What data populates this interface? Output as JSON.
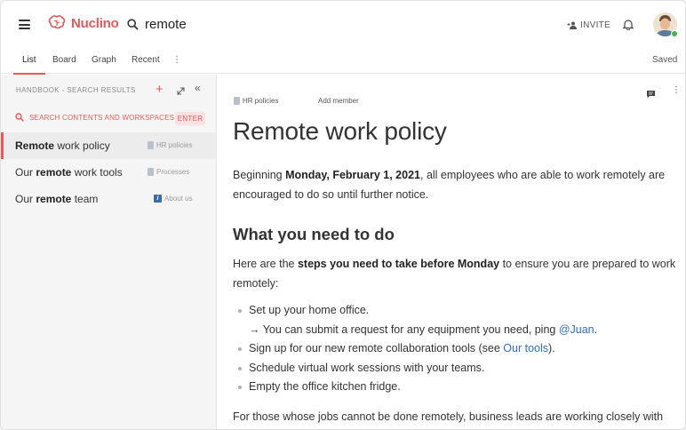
{
  "app": {
    "logo_text": "Nuclino",
    "search_query": "remote",
    "invite_label": "INVITE",
    "brand_color": "#e25a5a"
  },
  "tabs": [
    {
      "label": "List",
      "active": true
    },
    {
      "label": "Board",
      "active": false
    },
    {
      "label": "Graph",
      "active": false
    },
    {
      "label": "Recent",
      "active": false
    }
  ],
  "more_glyph": "⋮",
  "status": "Saved",
  "sidebar": {
    "header": "HANDBOOK - SEARCH RESULTS",
    "search_contents_label": "SEARCH CONTENTS AND WORKSPACES",
    "enter_label": "ENTER",
    "results": [
      {
        "pre": "",
        "bold": "Remote",
        "post": " work policy",
        "workspace": "HR policies",
        "icon": "doc-icon",
        "active": true
      },
      {
        "pre": "Our ",
        "bold": "remote",
        "post": " work tools",
        "workspace": "Processes",
        "icon": "doc-icon",
        "active": false
      },
      {
        "pre": "Our ",
        "bold": "remote",
        "post": " team",
        "workspace": "About us",
        "icon": "info-icon",
        "active": false
      }
    ]
  },
  "document": {
    "workspace": "HR policies",
    "add_member": "Add member",
    "title": "Remote work policy",
    "intro_pre": "Beginning ",
    "intro_bold": "Monday, February 1, 2021",
    "intro_post": ", all  employees who are able to work remotely are encouraged to do so until further notice.",
    "heading": "What you need to do",
    "steps_pre": "Here are the ",
    "steps_bold": "steps you need to take before Monday",
    "steps_post": " to ensure you are prepared to work remotely:",
    "list": {
      "item1": "Set up your home office.",
      "sub_arrow": "→",
      "sub_pre": " You can submit a request for any equipment you need, ping ",
      "sub_link": "@Juan",
      "sub_post": ".",
      "item2_pre": "Sign up for our new remote collaboration tools (see ",
      "item2_link": "Our tools",
      "item2_post": ").",
      "item3": "Schedule virtual work sessions with your teams.",
      "item4": "Empty the office kitchen fridge."
    },
    "closing": "For those whose jobs cannot be done remotely, business leads are working closely with"
  }
}
